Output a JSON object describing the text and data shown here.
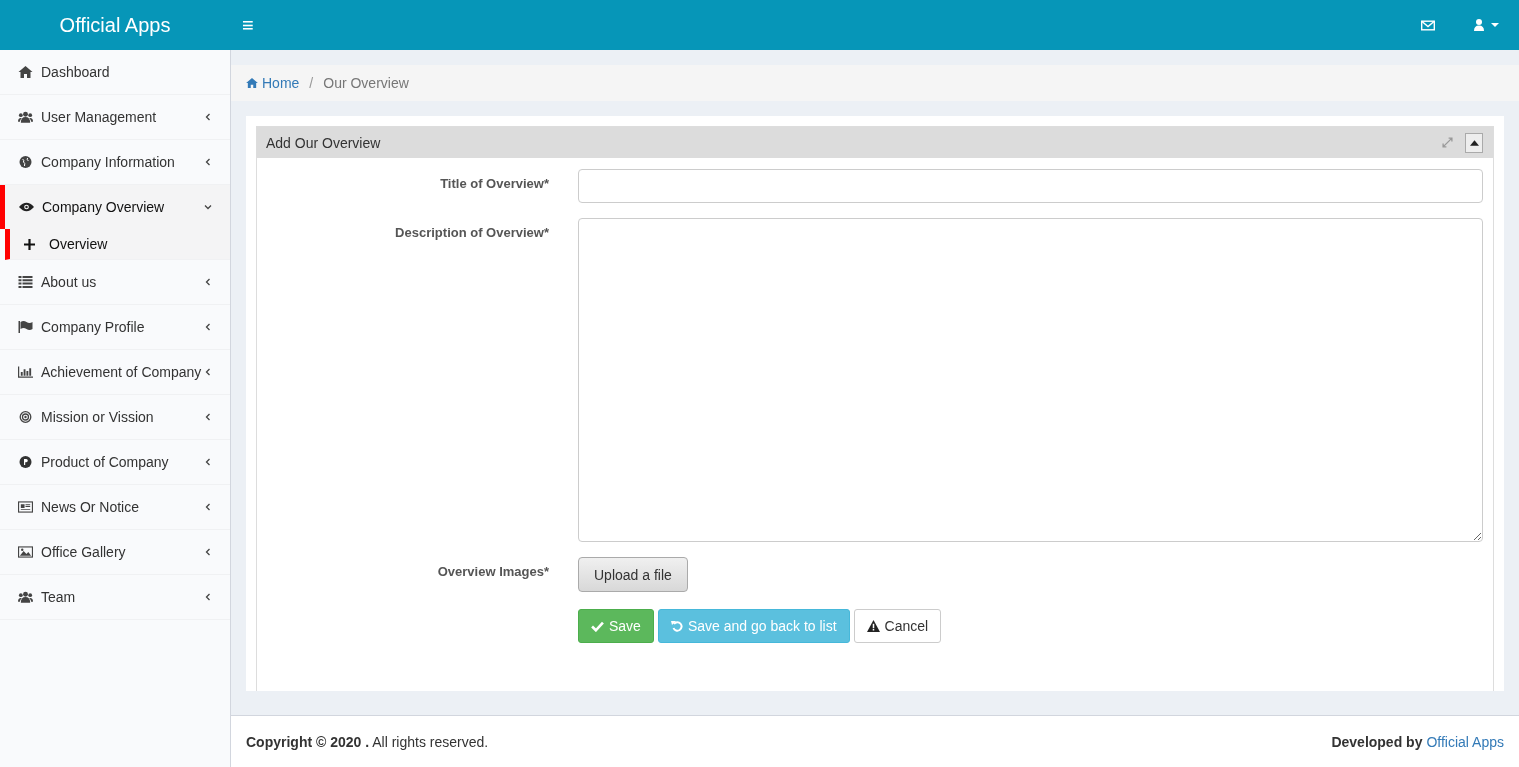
{
  "brand": "Official Apps",
  "header_menu": "≡",
  "sidebar": {
    "items": [
      {
        "label": "Dashboard",
        "selected": false
      },
      {
        "label": "User Management",
        "selected": false,
        "expanded": false
      },
      {
        "label": "Company Information",
        "selected": false,
        "expanded": false
      },
      {
        "label": "Company Overview",
        "selected": true,
        "expanded": true,
        "children": [
          {
            "label": "Overview",
            "selected": true
          }
        ]
      },
      {
        "label": "About us",
        "selected": false,
        "expanded": false
      },
      {
        "label": "Company Profile",
        "selected": false,
        "expanded": false
      },
      {
        "label": "Achievement of Company",
        "selected": false,
        "expanded": false
      },
      {
        "label": "Mission or Vission",
        "selected": false,
        "expanded": false
      },
      {
        "label": "Product of Company",
        "selected": false,
        "expanded": false
      },
      {
        "label": "News Or Notice",
        "selected": false,
        "expanded": false
      },
      {
        "label": "Office Gallery",
        "selected": false,
        "expanded": false
      },
      {
        "label": "Team",
        "selected": false,
        "expanded": false
      }
    ]
  },
  "breadcrumb": [
    "Home",
    "Our Overview"
  ],
  "breadcrumb_separator": "/",
  "panel": {
    "title": "Add Our Overview",
    "fields": [
      {
        "kind": "text",
        "label": "Title of Overview*"
      },
      {
        "kind": "textarea",
        "label": "Description of Overview*"
      },
      {
        "kind": "upload",
        "label": "Overview Images*",
        "button": "Upload a file"
      }
    ],
    "buttons": [
      {
        "kind": "save",
        "label": "Save"
      },
      {
        "kind": "back",
        "label": "Save and go back to list"
      },
      {
        "kind": "cancel",
        "label": "Cancel"
      }
    ]
  },
  "footer": {
    "left": "**Copyright © 2020 .** All rights reserved.",
    "right": "**Developed by**",
    "right_link": "Official Apps"
  }
}
